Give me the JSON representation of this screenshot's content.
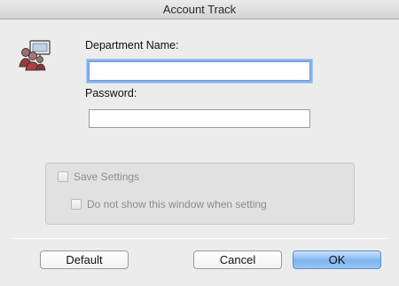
{
  "window": {
    "title": "Account Track"
  },
  "form": {
    "department_label": "Department Name:",
    "department_value": "",
    "password_label": "Password:",
    "password_value": ""
  },
  "options": {
    "save_settings_label": "Save Settings",
    "save_settings_checked": false,
    "do_not_show_label": "Do not show this window when setting",
    "do_not_show_checked": false
  },
  "buttons": {
    "default_label": "Default",
    "cancel_label": "Cancel",
    "ok_label": "OK"
  },
  "colors": {
    "ok_button": "#7cb3ee",
    "focus_ring": "#86b1ec",
    "disabled_text": "#8d8d8d"
  },
  "icons": {
    "app": "users-icon"
  }
}
